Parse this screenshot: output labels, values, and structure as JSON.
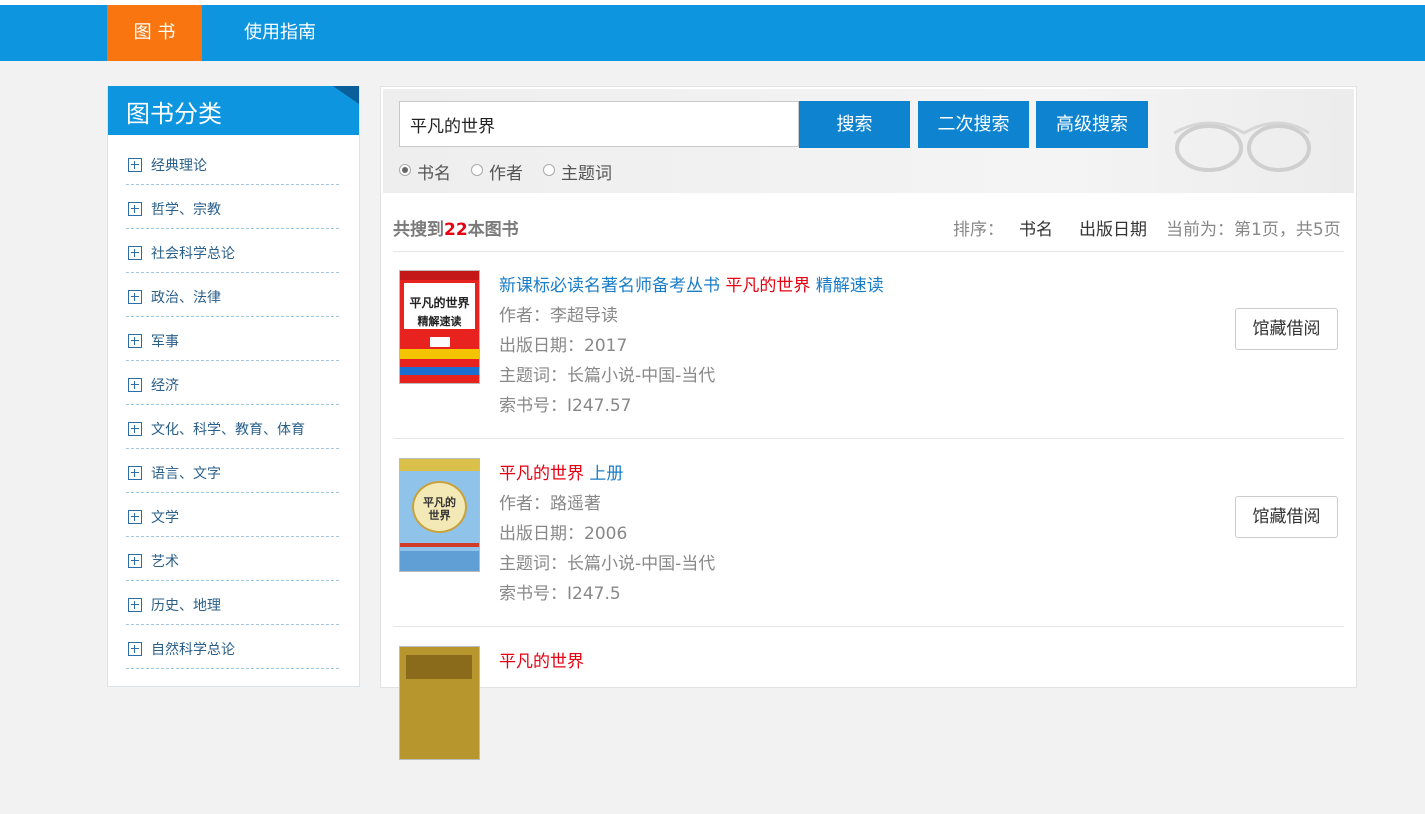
{
  "nav": {
    "tabs": [
      "图 书",
      "使用指南"
    ]
  },
  "sidebar": {
    "title": "图书分类",
    "categories": [
      "经典理论",
      "哲学、宗教",
      "社会科学总论",
      "政治、法律",
      "军事",
      "经济",
      "文化、科学、教育、体育",
      "语言、文字",
      "文学",
      "艺术",
      "历史、地理",
      "自然科学总论"
    ]
  },
  "search": {
    "value": "平凡的世界",
    "buttons": [
      "搜索",
      "二次搜索",
      "高级搜索"
    ],
    "options": [
      "书名",
      "作者",
      "主题词"
    ],
    "selected": "书名"
  },
  "results": {
    "count_prefix": "共搜到",
    "count": "22",
    "count_suffix": "本图书",
    "sort_label": "排序：",
    "sort_options": [
      "书名",
      "出版日期"
    ],
    "page_info": "当前为：第1页，共5页"
  },
  "books": [
    {
      "title_pre": "新课标必读名著名师备考丛书 ",
      "title_hl": "平凡的世界",
      "title_post": " 精解速读",
      "author": "作者：李超导读",
      "date": "出版日期：2017",
      "subject": "主题词：长篇小说-中国-当代",
      "call_no": "索书号：I247.57",
      "cover_title": "平凡的世界",
      "cover_sub": "精解速读",
      "action": "馆藏借阅"
    },
    {
      "title_pre": "",
      "title_hl": "平凡的世界",
      "title_post": " 上册",
      "author": "作者：路遥著",
      "date": "出版日期：2006",
      "subject": "主题词：长篇小说-中国-当代",
      "call_no": "索书号：I247.5",
      "cover_title": "平凡的世界",
      "action": "馆藏借阅"
    },
    {
      "title_pre": "",
      "title_hl": "平凡的世界",
      "title_post": ""
    }
  ],
  "colors": {
    "nav": "#0e95e0",
    "active_tab": "#f8750f",
    "highlight": "#e60012",
    "button": "#0e84d0"
  }
}
